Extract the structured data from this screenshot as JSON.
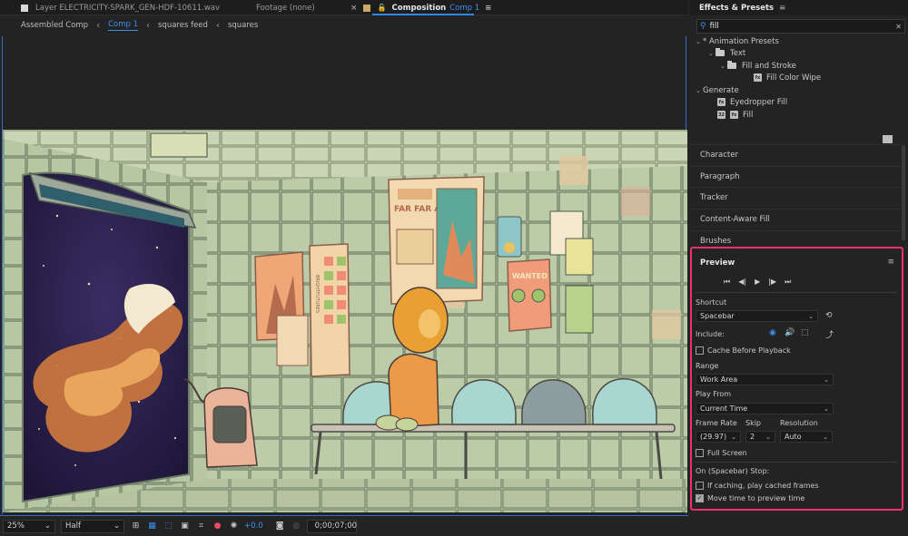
{
  "viewer": {
    "tabs": [
      {
        "label": "Layer ELECTRICITY-SPARK_GEN-HDF-10611.wav"
      },
      {
        "label": "Footage (none)"
      },
      {
        "label": "Composition",
        "comp": "Comp 1"
      }
    ],
    "breadcrumbs": [
      "Assembled Comp",
      "Comp 1",
      "squares feed",
      "squares"
    ],
    "poster_text": {
      "far_away": "FAR FAR AWAY",
      "wanted": "WANTED",
      "side_poster": "BRIGHTFUTURES"
    },
    "bottom_bar": {
      "zoom": "25%",
      "resolution": "Half",
      "exposure": "+0.0",
      "timecode": "0;00;07;00"
    }
  },
  "effects_presets": {
    "title": "Effects & Presets",
    "search_value": "fill",
    "tree": [
      {
        "label": "* Animation Presets",
        "level": 0,
        "type": "group"
      },
      {
        "label": "Text",
        "level": 1,
        "type": "folder"
      },
      {
        "label": "Fill and Stroke",
        "level": 2,
        "type": "folder"
      },
      {
        "label": "Fill Color Wipe",
        "level": 3,
        "type": "preset"
      },
      {
        "label": "Generate",
        "level": 0,
        "type": "group"
      },
      {
        "label": "Eyedropper Fill",
        "level": 1,
        "type": "effect"
      },
      {
        "label": "Fill",
        "level": 1,
        "type": "effect"
      }
    ]
  },
  "panels": [
    "Character",
    "Paragraph",
    "Tracker",
    "Content-Aware Fill",
    "Brushes"
  ],
  "preview": {
    "title": "Preview",
    "shortcut_label": "Shortcut",
    "shortcut_value": "Spacebar",
    "include_label": "Include:",
    "cache_before_playback": "Cache Before Playback",
    "range_label": "Range",
    "range_value": "Work Area",
    "play_from_label": "Play From",
    "play_from_value": "Current Time",
    "frame_rate_label": "Frame Rate",
    "frame_rate_value": "(29.97)",
    "skip_label": "Skip",
    "skip_value": "2",
    "resolution_label": "Resolution",
    "resolution_value": "Auto",
    "full_screen": "Full Screen",
    "on_stop_label": "On (Spacebar) Stop:",
    "if_caching": "If caching, play cached frames",
    "move_time": "Move time to preview time",
    "accent_color": "#f0306c"
  }
}
